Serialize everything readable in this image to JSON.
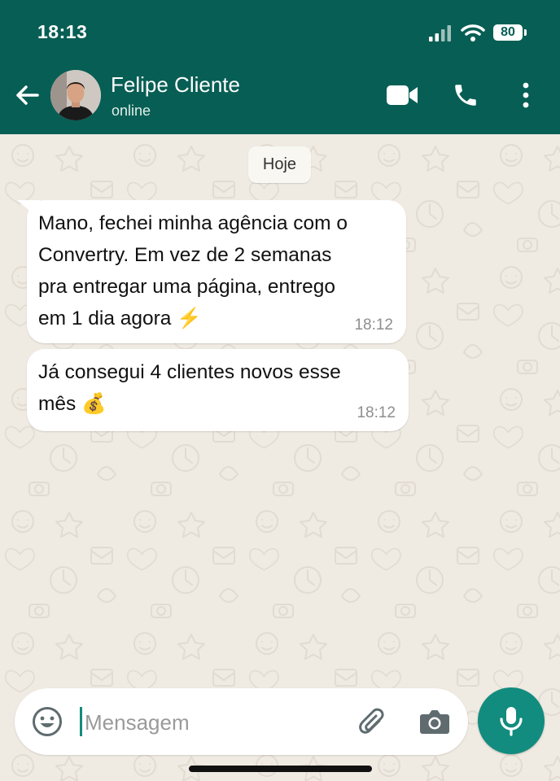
{
  "status_bar": {
    "time": "18:13",
    "battery": "80"
  },
  "contact": {
    "name": "Felipe Cliente",
    "status": "online"
  },
  "chat": {
    "date_chip": "Hoje",
    "messages": [
      {
        "text": "Mano, fechei minha agência com o\nConvertry. Em vez de 2 semanas\npra entregar uma página, entrego\nem 1 dia agora ⚡",
        "time": "18:12"
      },
      {
        "text": "Já consegui 4 clientes novos esse\nmês 💰",
        "time": "18:12"
      }
    ]
  },
  "composer": {
    "placeholder": "Mensagem"
  },
  "colors": {
    "header": "#075e54",
    "accent": "#128c7e",
    "background": "#efeae2"
  },
  "icons": [
    "signal-icon",
    "wifi-icon",
    "battery-icon",
    "back-arrow-icon",
    "video-call-icon",
    "phone-icon",
    "more-vert-icon",
    "emoji-icon",
    "attach-icon",
    "camera-icon",
    "mic-icon"
  ]
}
